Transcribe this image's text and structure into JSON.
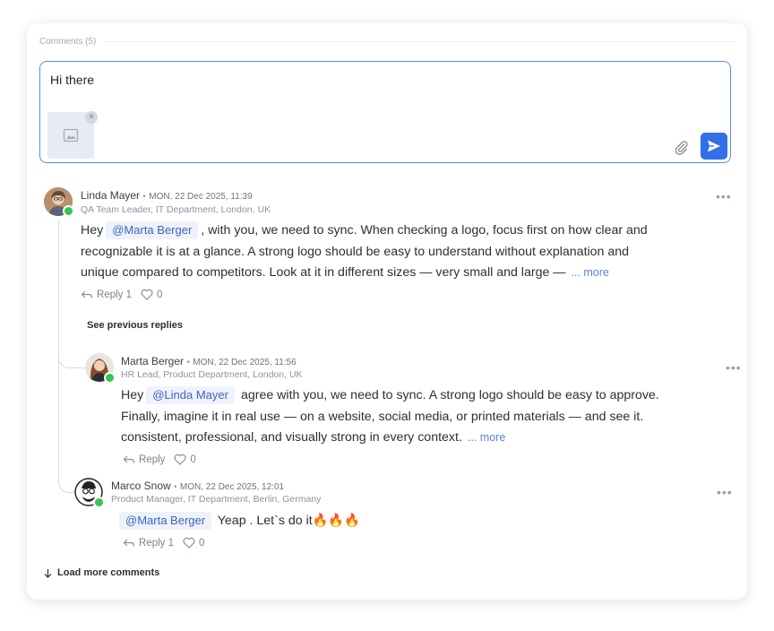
{
  "section": {
    "title": "Comments (5)"
  },
  "composer": {
    "text": "Hi there",
    "remove_label": "×"
  },
  "comments": [
    {
      "author": "Linda Mayer",
      "separator": "•",
      "timestamp": "MON, 22 Dec 2025, 11:39",
      "role": "QA Team Leader, IT Department, London, UK",
      "text_before": "Hey",
      "mention": "@Marta Berger",
      "text_line1_after": ", with you, we need to sync. When checking a logo, focus first on how clear and",
      "text_line2": "recognizable it is at a glance. A strong logo should be easy to understand without explanation and",
      "text_line3": "unique compared to competitors. Look at it in different sizes — very small and large —",
      "more": "... more",
      "reply": "Reply 1",
      "likes": "0"
    },
    {
      "author": "Marta Berger",
      "separator": "•",
      "timestamp": "MON, 22 Dec 2025, 11:56",
      "role": "HR Lead, Product Department, London, UK",
      "text_before": "Hey",
      "mention": "@Linda Mayer",
      "text_line1_after": "agree with you, we need to sync. A strong logo should be easy to approve.",
      "text_line2": "Finally, imagine it in real use — on a website, social media, or printed materials — and see it.",
      "text_line3": "consistent, professional, and visually strong in every context.",
      "more": "... more",
      "reply": "Reply",
      "likes": "0"
    },
    {
      "author": "Marco Snow",
      "separator": "•",
      "timestamp": "MON, 22 Dec 2025, 12:01",
      "role": "Product Manager, IT Department, Berlin, Germany",
      "mention": "@Marta Berger",
      "text": "Yeap . Let`s do it🔥🔥🔥",
      "reply": "Reply 1",
      "likes": "0"
    }
  ],
  "see_previous": "See previous replies",
  "load_more": "Load more comments",
  "menu_dots": "•••",
  "colors": {
    "accent": "#2f6fe8",
    "border_focus": "#5b8def",
    "online": "#3ac34f",
    "mention_bg": "#eef2fb",
    "mention_text": "#3c64c4"
  }
}
